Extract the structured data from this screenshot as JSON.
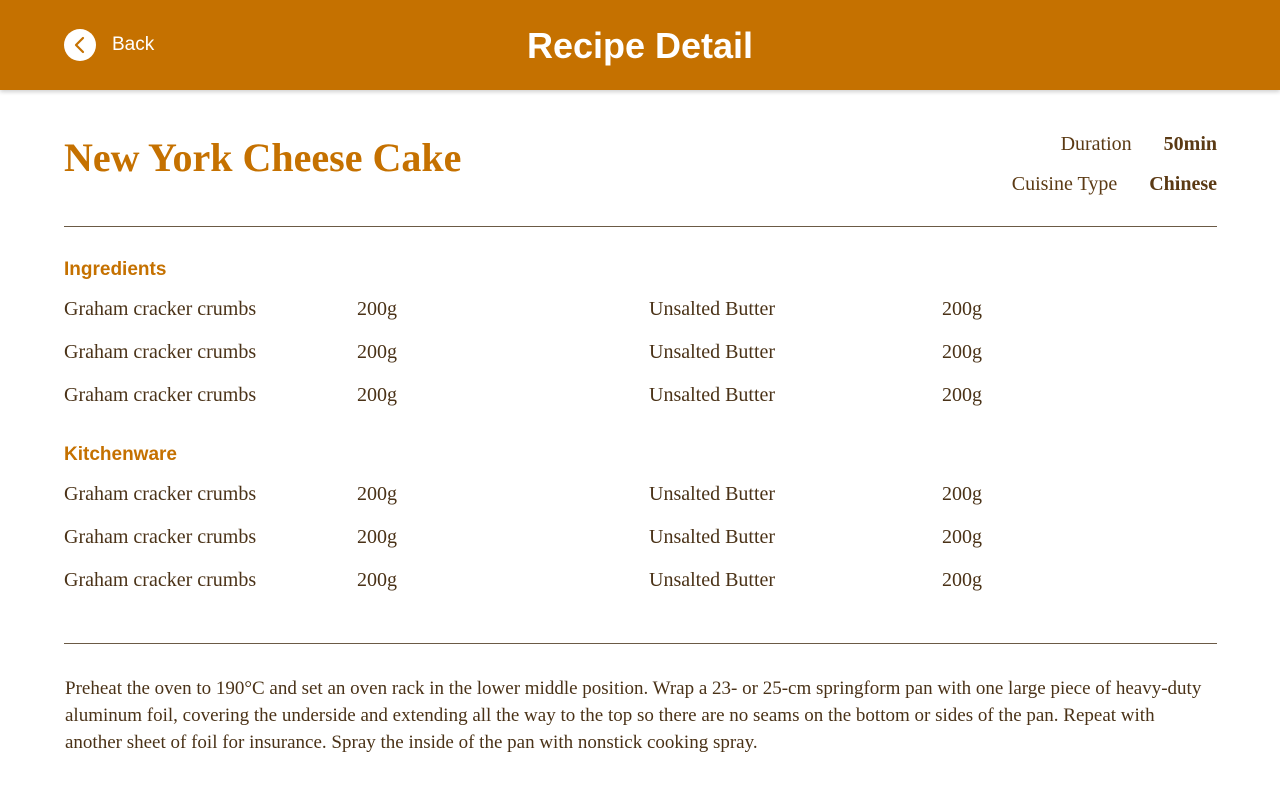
{
  "header": {
    "back_label": "Back",
    "title": "Recipe Detail",
    "back_icon": "chevron-left-icon",
    "color": "#c57100"
  },
  "recipe": {
    "name": "New York Cheese Cake",
    "duration_label": "Duration",
    "duration_value": "50min",
    "cuisine_label": "Cuisine Type",
    "cuisine_value": "Chinese"
  },
  "ingredients": {
    "heading": "Ingredients",
    "rows": [
      {
        "item1": "Graham cracker crumbs",
        "qty1": "200g",
        "item2": "Unsalted Butter",
        "qty2": "200g"
      },
      {
        "item1": "Graham cracker crumbs",
        "qty1": "200g",
        "item2": "Unsalted Butter",
        "qty2": "200g"
      },
      {
        "item1": "Graham cracker crumbs",
        "qty1": "200g",
        "item2": "Unsalted Butter",
        "qty2": "200g"
      }
    ]
  },
  "kitchenware": {
    "heading": "Kitchenware",
    "rows": [
      {
        "item1": "Graham cracker crumbs",
        "qty1": "200g",
        "item2": "Unsalted Butter",
        "qty2": "200g"
      },
      {
        "item1": "Graham cracker crumbs",
        "qty1": "200g",
        "item2": "Unsalted Butter",
        "qty2": "200g"
      },
      {
        "item1": "Graham cracker crumbs",
        "qty1": "200g",
        "item2": "Unsalted Butter",
        "qty2": "200g"
      }
    ]
  },
  "instructions": "Preheat the oven to 190°C and set an oven rack in the lower middle position. Wrap a 23- or 25-cm springform pan with one large piece of heavy-duty aluminum foil, covering the underside and extending all the way to the top so there are no seams on the bottom or sides of the pan. Repeat with another sheet of foil for insurance. Spray the inside of the pan with nonstick cooking spray."
}
